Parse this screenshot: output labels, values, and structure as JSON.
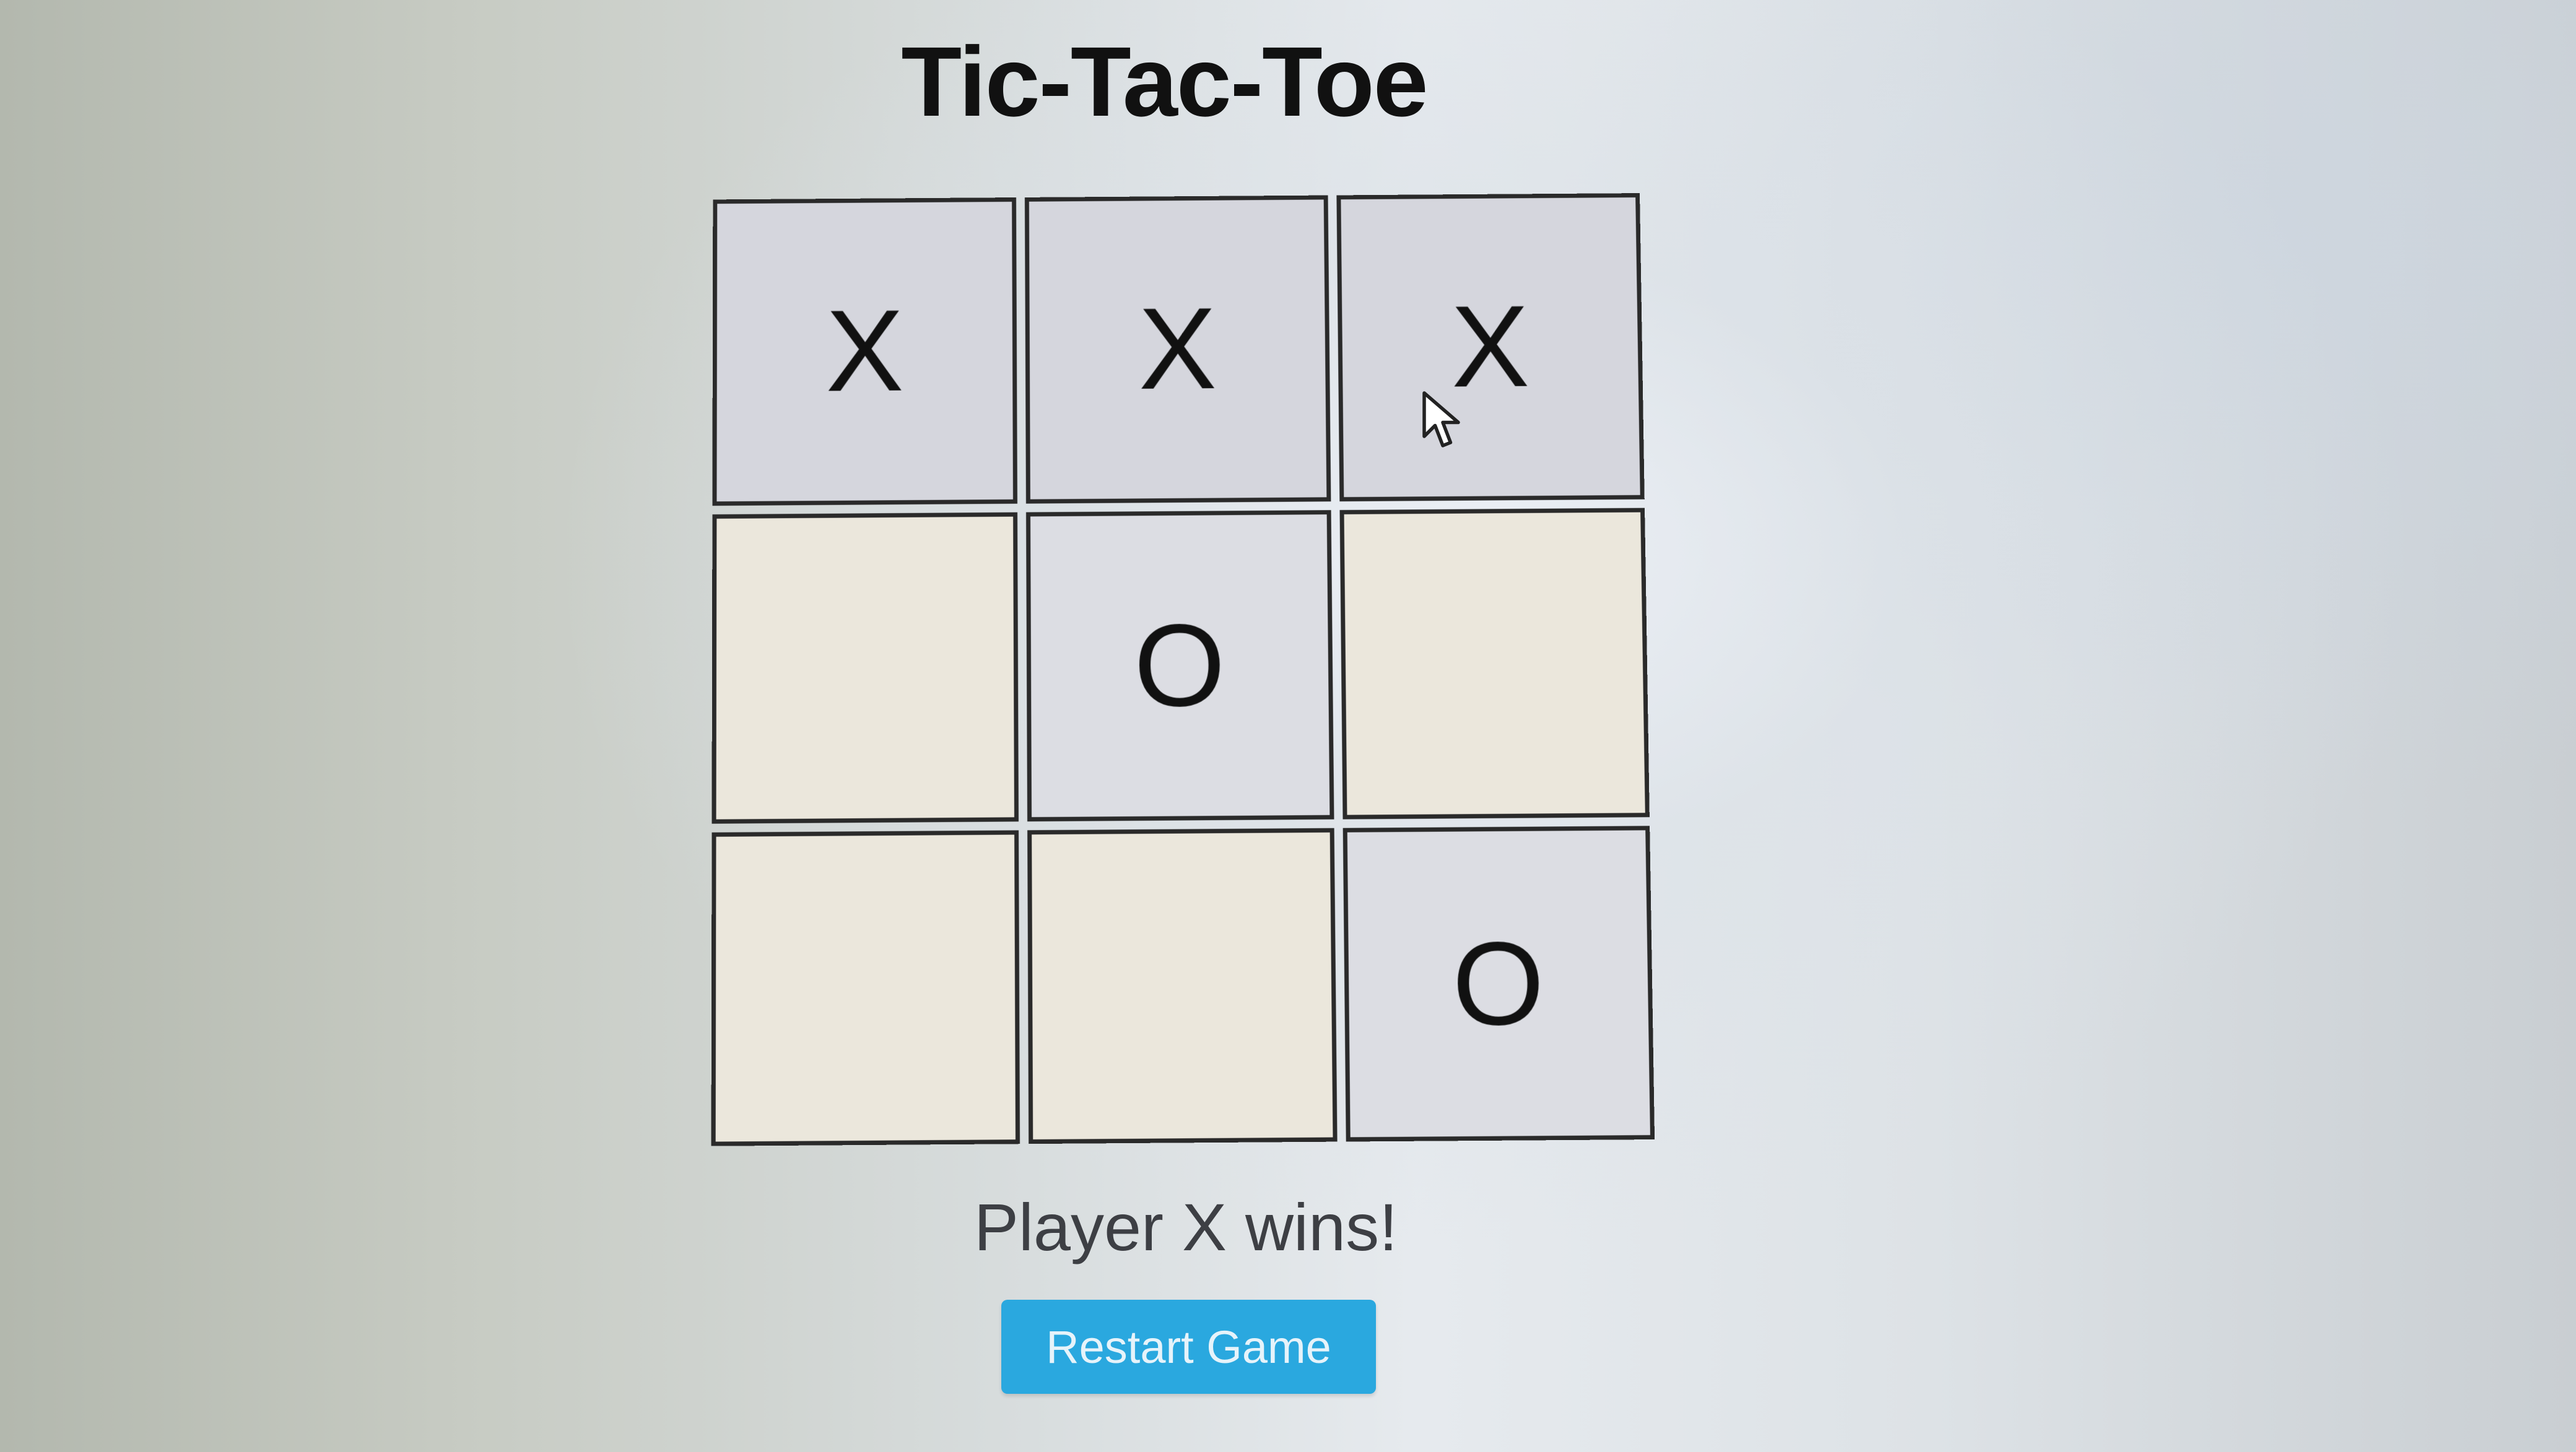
{
  "game": {
    "title": "Tic-Tac-Toe",
    "status": "Player X wins!",
    "restart_label": "Restart Game",
    "board": [
      [
        "X",
        "X",
        "X"
      ],
      [
        "",
        "O",
        ""
      ],
      [
        "",
        "",
        "O"
      ]
    ]
  },
  "colors": {
    "button": "#2aa8df",
    "marked_cell": "#dcdde3",
    "empty_cell": "#ebe7dc",
    "border": "#2a2a2a"
  },
  "icons": {
    "pointer": "mouse-pointer-icon"
  }
}
